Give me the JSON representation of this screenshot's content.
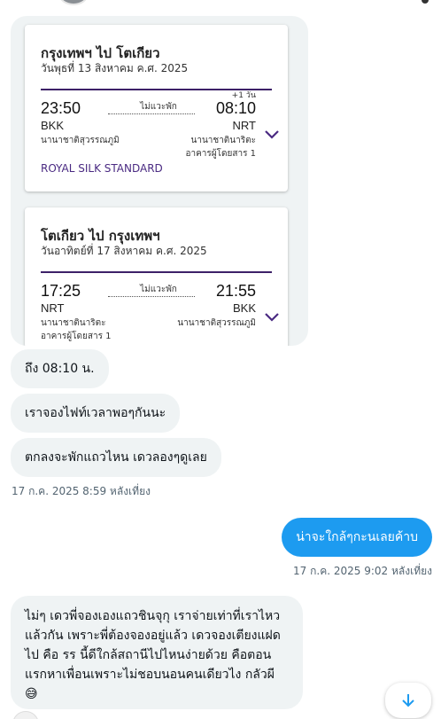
{
  "flights": [
    {
      "route": "กรุงเทพฯ ไป โตเกียว",
      "date": "วันพุธที่ 13 สิงหาคม ค.ศ. 2025",
      "dep_time": "23:50",
      "arr_time": "08:10",
      "day_offset": "+1 วัน",
      "stops": "ไม่แวะพัก",
      "dep_code": "BKK",
      "arr_code": "NRT",
      "dep_airport": [
        "นานาชาติสุวรรณภูมิ"
      ],
      "arr_airport": [
        "นานาชาตินาริตะ",
        "อาคารผู้โดยสาร 1"
      ],
      "fare_class": "ROYAL SILK STANDARD"
    },
    {
      "route": "โตเกียว ไป กรุงเทพฯ",
      "date": "วันอาทิตย์ที่ 17 สิงหาคม ค.ศ. 2025",
      "dep_time": "17:25",
      "arr_time": "21:55",
      "stops": "ไม่แวะพัก",
      "dep_code": "NRT",
      "arr_code": "BKK",
      "dep_airport": [
        "นานาชาตินาริตะ",
        "อาคารผู้โดยสาร 1"
      ],
      "arr_airport": [
        "นานาชาติสุวรรณภูมิ"
      ]
    }
  ],
  "messages": {
    "received_1": "ถึง 08:10 น.",
    "received_2": "เราจองไฟท์เวลาพอๆกันนะ",
    "received_3": "ตกลงจะพักแถวไหน เดวลองๆดูเลย",
    "timestamp_1": "17 ก.ค. 2025 8:59 หลังเที่ยง",
    "sent_1": "น่าจะใกล้ๆกะนเลยค้าบ",
    "timestamp_2": "17 ก.ค. 2025 9:02 หลังเที่ยง",
    "received_4": "ไม่ๆ เดวพี่จองเองแถวชินจุกุ เราจ่ายเท่าที่เราไหว แล้วกัน เพราะพี่ต้องจองอยู่แล้ว เดวจองเตียงแฝด ไป คือ รร นี้ดีใกล้สถานีไปไหนง่ายด้วย คือตอน แรกหาเพื่อนเพราะไม่ชอบนอนคนเดียวไง กลัวผี 😅"
  },
  "colors": {
    "accent": "#1d9bf0",
    "bubble": "#eff3f4",
    "brand_purple": "#4a2a82"
  },
  "icons": {
    "expand": "chevron-down-icon",
    "scroll": "arrow-down-icon"
  }
}
